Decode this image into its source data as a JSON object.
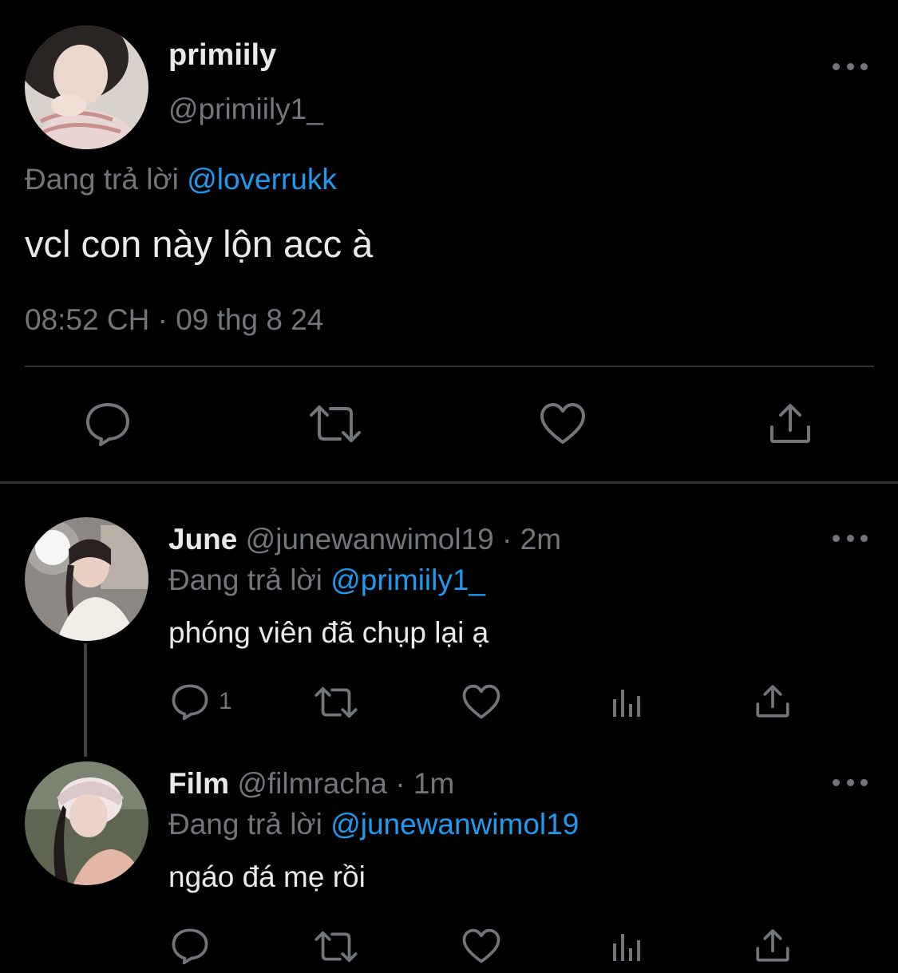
{
  "main_tweet": {
    "display_name": "primiily",
    "handle": "@primiily1_",
    "replying_prefix": "Đang trả lời ",
    "replying_to": "@loverrukk",
    "text": "vcl con này lộn acc à",
    "timestamp": "08:52 CH · 09 thg 8 24",
    "actions": [
      "reply-icon",
      "retweet-icon",
      "like-icon",
      "share-icon"
    ]
  },
  "replies": [
    {
      "display_name": "June",
      "handle": "@junewanwimol19",
      "separator": " · ",
      "time": "2m",
      "replying_prefix": "Đang trả lời ",
      "replying_to": "@primiily1_",
      "text": "phóng viên đã chụp lại ạ",
      "reply_count": "1",
      "actions": [
        "reply-icon",
        "retweet-icon",
        "like-icon",
        "views-icon",
        "share-icon"
      ]
    },
    {
      "display_name": "Film",
      "handle": "@filmracha",
      "separator": " · ",
      "time": "1m",
      "replying_prefix": "Đang trả lời ",
      "replying_to": "@junewanwimol19",
      "text": "ngáo đá mẹ rồi",
      "reply_count": "",
      "actions": [
        "reply-icon",
        "retweet-icon",
        "like-icon",
        "views-icon",
        "share-icon"
      ]
    }
  ],
  "colors": {
    "background": "#000000",
    "text_primary": "#e7e9ea",
    "text_secondary": "#71767b",
    "link": "#1d9bf0",
    "divider": "#2f3336"
  }
}
